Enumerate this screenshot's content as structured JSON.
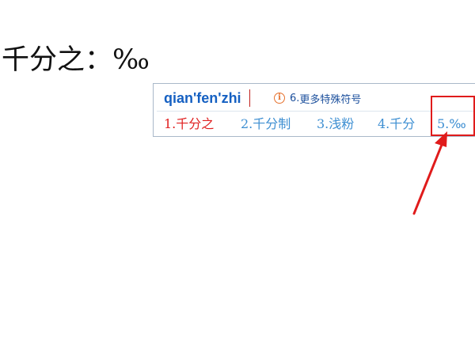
{
  "document": {
    "text": "千分之：‰"
  },
  "ime": {
    "composition": "qian'fen'zhi",
    "hint": {
      "number": "6.",
      "label": "更多特殊符号",
      "icon": "info-icon"
    },
    "candidates": [
      {
        "index": "1.",
        "text": "千分之",
        "selected": true
      },
      {
        "index": "2.",
        "text": "千分制",
        "selected": false
      },
      {
        "index": "3.",
        "text": "浅粉",
        "selected": false
      },
      {
        "index": "4.",
        "text": "千分",
        "selected": false
      },
      {
        "index": "5.",
        "text": "‰",
        "selected": false
      }
    ]
  },
  "annotation": {
    "color": "#e01b1b",
    "highlighted": "5.‰"
  }
}
